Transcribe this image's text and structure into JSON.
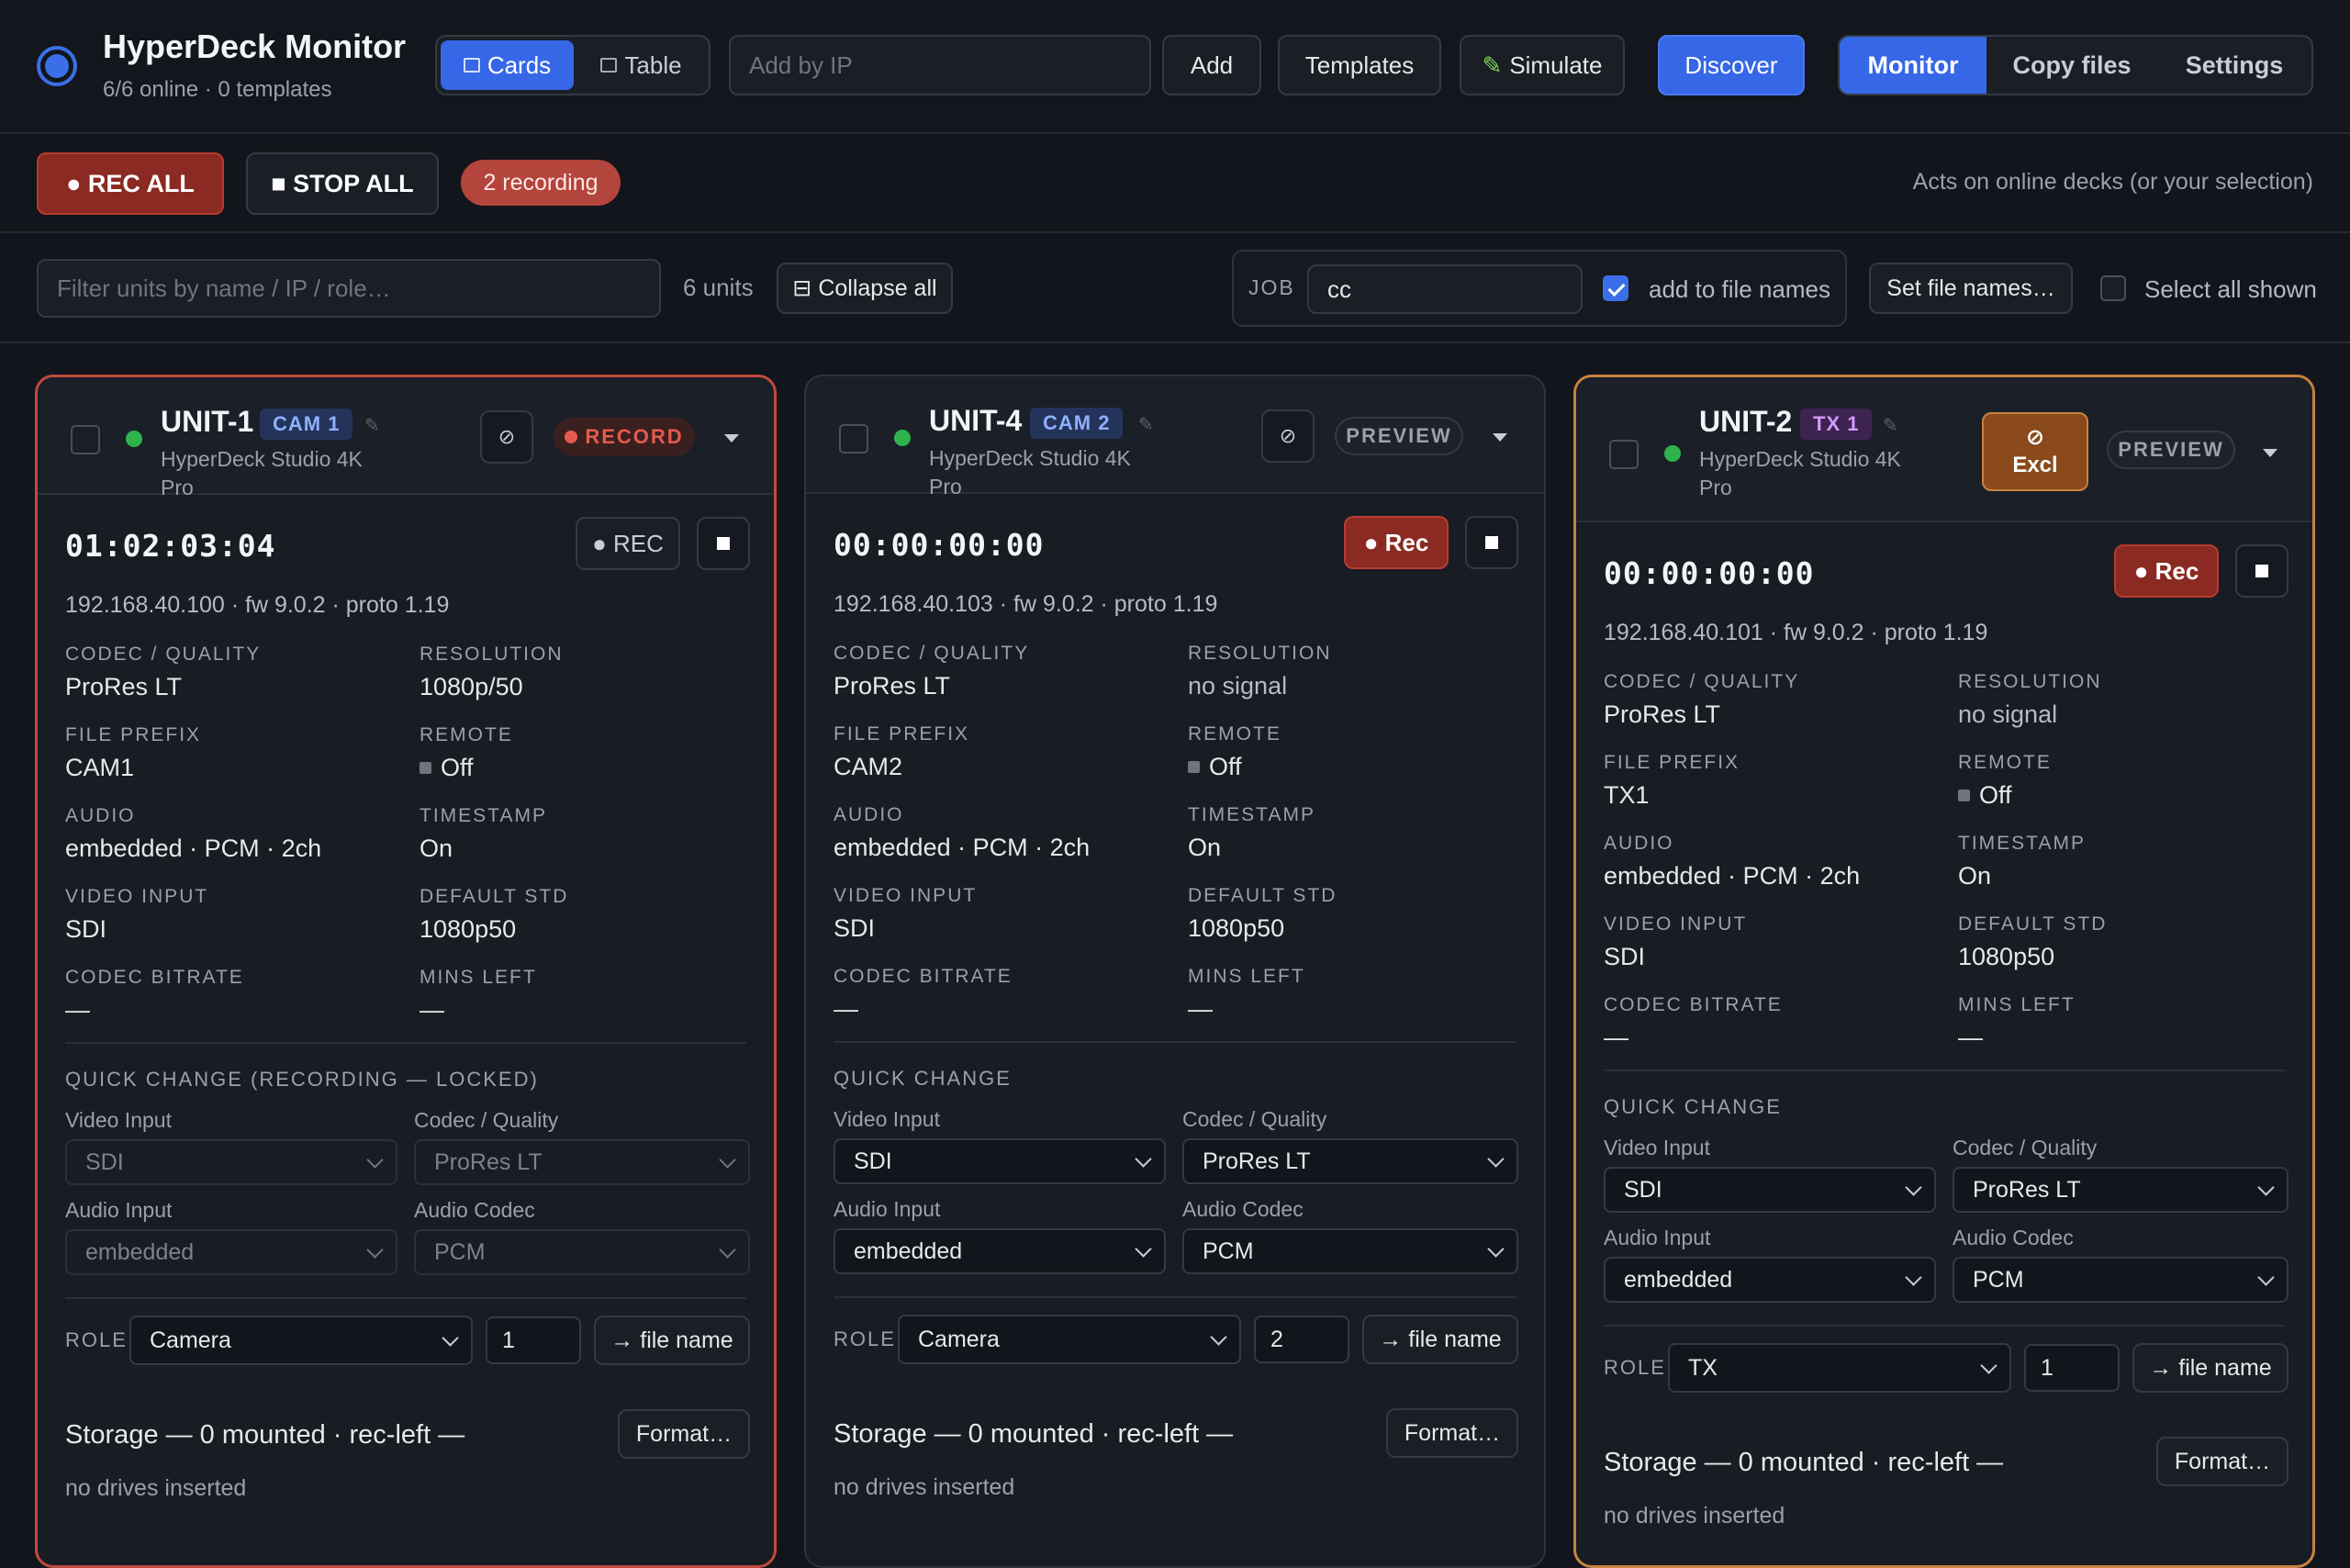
{
  "app": {
    "title": "HyperDeck Monitor",
    "subtitle": "6/6 online · 0 templates"
  },
  "header": {
    "view_cards": "Cards",
    "view_table": "Table",
    "add_ip_placeholder": "Add by IP",
    "add": "Add",
    "templates": "Templates",
    "simulate": "Simulate",
    "discover": "Discover",
    "nav": [
      "Monitor",
      "Copy files",
      "Settings"
    ]
  },
  "recbar": {
    "rec_all": "● REC ALL",
    "stop_all": "■ STOP ALL",
    "recording": "2 recording",
    "hint": "Acts on online decks (or your selection)"
  },
  "filter": {
    "placeholder": "Filter units by name / IP / role…",
    "count": "6 units",
    "collapse": "⊟ Collapse all",
    "job_label": "JOB",
    "job_value": "cc",
    "add_to_names": "add to file names",
    "set_names": "Set file names…",
    "select_all": "Select all shown"
  },
  "labels": {
    "codec": "CODEC / QUALITY",
    "resolution": "RESOLUTION",
    "prefix": "FILE PREFIX",
    "remote": "REMOTE",
    "audio": "AUDIO",
    "timestamp": "TIMESTAMP",
    "video_input": "VIDEO INPUT",
    "default_std": "DEFAULT STD",
    "bitrate": "CODEC BITRATE",
    "mins_left": "MINS LEFT",
    "qc_video": "Video Input",
    "qc_codec": "Codec / Quality",
    "qc_audio": "Audio Input",
    "qc_acodec": "Audio Codec",
    "role": "ROLE",
    "file_name": "→ file name",
    "format": "Format…",
    "no_drives": "no drives inserted"
  },
  "units": [
    {
      "name": "UNIT-1",
      "badge": "CAM 1",
      "model": "HyperDeck Studio 4K Pro",
      "state": "RECORD",
      "timecode": "01:02:03:04",
      "rec_label": "● REC",
      "ip": "192.168.40.100 · fw 9.0.2 · proto 1.19",
      "codec": "ProRes LT",
      "resolution": "1080p/50",
      "prefix": "CAM1",
      "remote": "Off",
      "audio": "embedded · PCM · 2ch",
      "timestamp": "On",
      "video_input": "SDI",
      "default_std": "1080p50",
      "bitrate": "—",
      "mins_left": "—",
      "qc_title": "QUICK CHANGE (RECORDING — LOCKED)",
      "qc_video": "SDI",
      "qc_codec": "ProRes LT",
      "qc_audio": "embedded",
      "qc_acodec": "PCM",
      "role": "Camera",
      "role_num": "1",
      "storage": "Storage — 0 mounted · rec-left —"
    },
    {
      "name": "UNIT-4",
      "badge": "CAM 2",
      "model": "HyperDeck Studio 4K Pro",
      "state": "PREVIEW",
      "timecode": "00:00:00:00",
      "rec_label": "● Rec",
      "ip": "192.168.40.103 · fw 9.0.2 · proto 1.19",
      "codec": "ProRes LT",
      "resolution": "no signal",
      "prefix": "CAM2",
      "remote": "Off",
      "audio": "embedded · PCM · 2ch",
      "timestamp": "On",
      "video_input": "SDI",
      "default_std": "1080p50",
      "bitrate": "—",
      "mins_left": "—",
      "qc_title": "QUICK CHANGE",
      "qc_video": "SDI",
      "qc_codec": "ProRes LT",
      "qc_audio": "embedded",
      "qc_acodec": "PCM",
      "role": "Camera",
      "role_num": "2",
      "storage": "Storage — 0 mounted · rec-left —"
    },
    {
      "name": "UNIT-2",
      "badge": "TX 1",
      "model": "HyperDeck Studio 4K Pro",
      "state": "PREVIEW",
      "excl_icon": "⊘",
      "excl_label": "Excl",
      "timecode": "00:00:00:00",
      "rec_label": "● Rec",
      "ip": "192.168.40.101 · fw 9.0.2 · proto 1.19",
      "codec": "ProRes LT",
      "resolution": "no signal",
      "prefix": "TX1",
      "remote": "Off",
      "audio": "embedded · PCM · 2ch",
      "timestamp": "On",
      "video_input": "SDI",
      "default_std": "1080p50",
      "bitrate": "—",
      "mins_left": "—",
      "qc_title": "QUICK CHANGE",
      "qc_video": "SDI",
      "qc_codec": "ProRes LT",
      "qc_audio": "embedded",
      "qc_acodec": "PCM",
      "role": "TX",
      "role_num": "1",
      "storage": "Storage — 0 mounted · rec-left —"
    }
  ]
}
